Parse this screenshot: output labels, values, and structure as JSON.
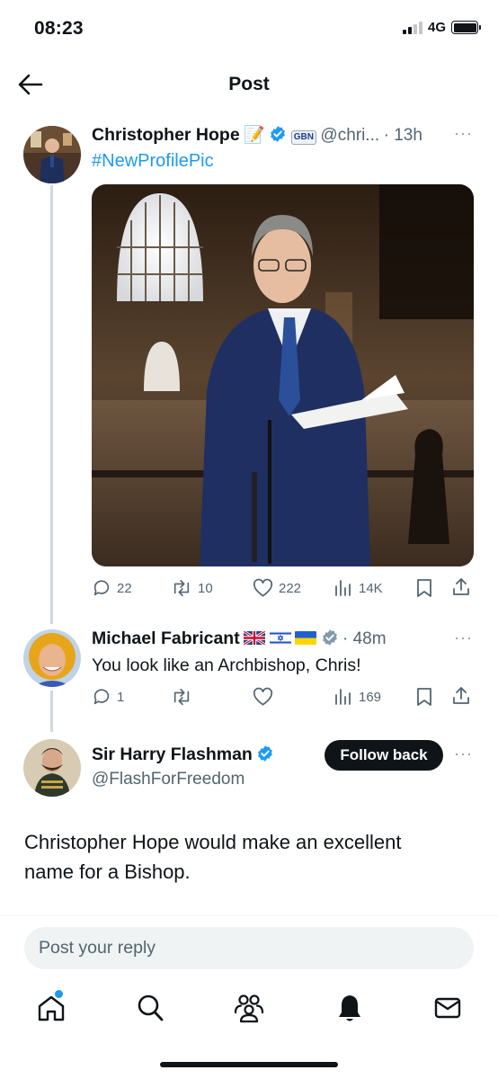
{
  "status_bar": {
    "time": "08:23",
    "network": "4G"
  },
  "header": {
    "title": "Post"
  },
  "tweet": {
    "author_name": "Christopher Hope",
    "author_emoji": "📝",
    "badge_text": "GBN",
    "handle": "@chri...",
    "time": "· 13h",
    "hashtag": "#NewProfilePic",
    "stats": {
      "replies": "22",
      "reposts": "10",
      "likes": "222",
      "views": "14K"
    }
  },
  "reply": {
    "author_name": "Michael Fabricant",
    "time": "· 48m",
    "text": "You look like an Archbishop, Chris!",
    "stats": {
      "replies": "1",
      "reposts": "",
      "likes": "",
      "views": "169"
    }
  },
  "main_post": {
    "author_name": "Sir Harry Flashman",
    "handle": "@FlashForFreedom",
    "follow_label": "Follow back",
    "text": "Christopher Hope would make an excellent name for a Bishop."
  },
  "composer": {
    "placeholder": "Post your reply"
  },
  "nav": {
    "items": [
      "home-icon",
      "search-icon",
      "communities-icon",
      "notifications-icon",
      "messages-icon"
    ]
  },
  "colors": {
    "accent": "#1d9bf0",
    "verified_gray": "#829aab",
    "text": "#0f1419",
    "muted": "#536471"
  },
  "more_glyph": "···"
}
